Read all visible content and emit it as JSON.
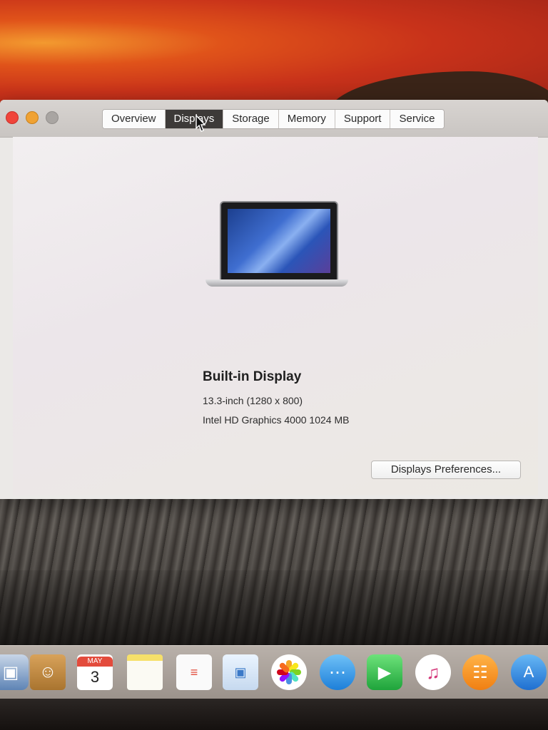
{
  "window": {
    "tabs": [
      {
        "label": "Overview",
        "active": false
      },
      {
        "label": "Displays",
        "active": true
      },
      {
        "label": "Storage",
        "active": false
      },
      {
        "label": "Memory",
        "active": false
      },
      {
        "label": "Support",
        "active": false
      },
      {
        "label": "Service",
        "active": false
      }
    ]
  },
  "display_info": {
    "title": "Built-in Display",
    "size_resolution": "13.3-inch (1280 x 800)",
    "graphics": "Intel HD Graphics 4000 1024 MB"
  },
  "buttons": {
    "preferences_label": "Displays Preferences..."
  },
  "dock": {
    "calendar_month": "MAY",
    "calendar_day": "3",
    "icons": [
      "preview-icon",
      "contacts-icon",
      "calendar-icon",
      "notes-icon",
      "reminders-icon",
      "photo-booth-icon",
      "photos-icon",
      "messages-icon",
      "facetime-icon",
      "itunes-icon",
      "ibooks-icon",
      "app-store-icon"
    ]
  },
  "colors": {
    "close": "#f0443a",
    "minimize": "#f0a233",
    "zoom_inactive": "#a9a5a2",
    "active_tab": "#3d3a38"
  }
}
